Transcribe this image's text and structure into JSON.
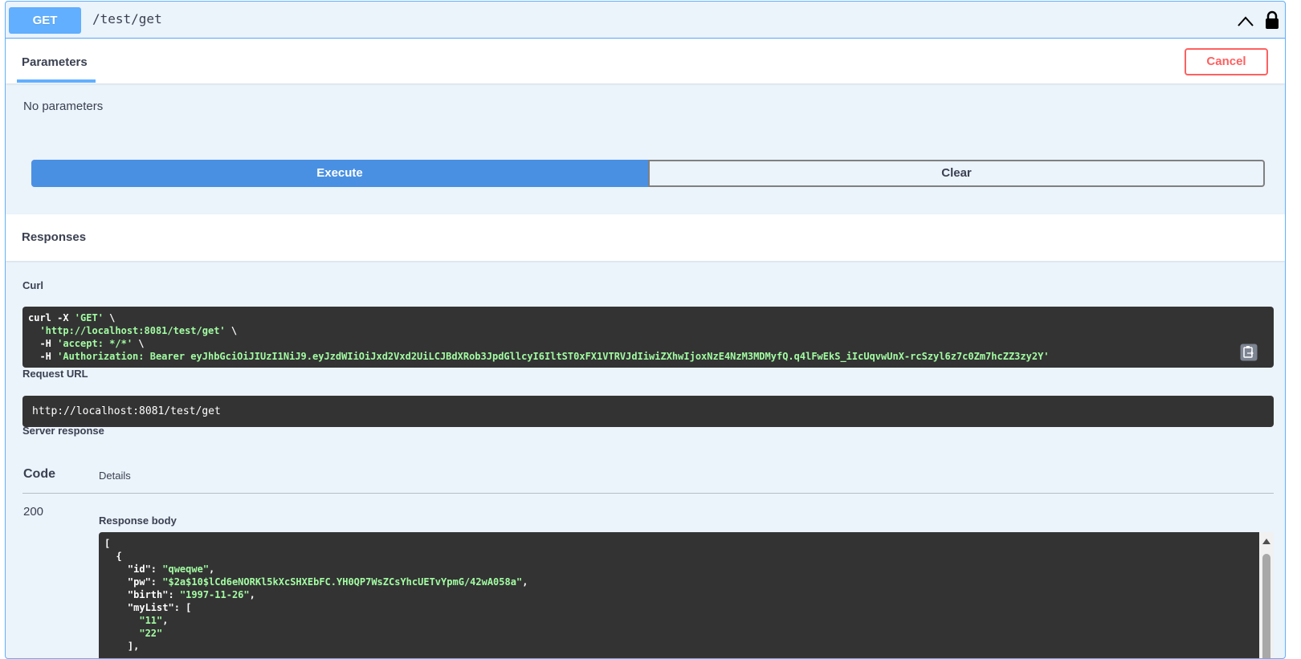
{
  "operation": {
    "method": "GET",
    "path": "/test/get",
    "icons": {
      "collapse": "chevron-up-icon",
      "lock": "lock-icon"
    }
  },
  "tabs": {
    "parameters": "Parameters",
    "cancel": "Cancel"
  },
  "parameters": {
    "empty_text": "No parameters"
  },
  "actions": {
    "execute": "Execute",
    "clear": "Clear"
  },
  "responses": {
    "title": "Responses",
    "curl_label": "Curl",
    "curl": {
      "l1_prefix": "curl -X ",
      "l1_str": "'GET'",
      "l1_suffix": " \\",
      "l2_prefix": "  ",
      "l2_str": "'http://localhost:8081/test/get'",
      "l2_suffix": " \\",
      "l3_prefix": "  -H ",
      "l3_str": "'accept: */*'",
      "l3_suffix": " \\",
      "l4_prefix": "  -H ",
      "l4_str": "'Authorization: Bearer eyJhbGciOiJIUzI1NiJ9.eyJzdWIiOiJxd2Vxd2UiLCJBdXRob3JpdGllcyI6IltST0xFX1VTRVJdIiwiZXhwIjoxNzE4NzM3MDMyfQ.q4lFwEkS_iIcUqvwUnX-rcSzyl6z7c0Zm7hcZZ3zy2Y'"
    },
    "request_url_label": "Request URL",
    "request_url": "http://localhost:8081/test/get",
    "server_response_label": "Server response",
    "col_code": "Code",
    "col_details": "Details",
    "status_code": "200",
    "response_body_label": "Response body",
    "body": {
      "l1": "[",
      "l2": "  {",
      "l3_key": "    \"id\"",
      "l3_sep": ": ",
      "l3_val": "\"qweqwe\"",
      "l3_end": ",",
      "l4_key": "    \"pw\"",
      "l4_sep": ": ",
      "l4_val": "\"$2a$10$lCd6eNORKl5kXcSHXEbFC.YH0QP7WsZCsYhcUETvYpmG/42wA058a\"",
      "l4_end": ",",
      "l5_key": "    \"birth\"",
      "l5_sep": ": ",
      "l5_val": "\"1997-11-26\"",
      "l5_end": ",",
      "l6_key": "    \"myList\"",
      "l6_sep": ": [",
      "l7_val": "      \"11\"",
      "l7_end": ",",
      "l8_val": "      \"22\"",
      "l9": "    ],"
    }
  },
  "colors": {
    "get": "#61affe",
    "cancel": "#ff6060",
    "execute": "#4990e2",
    "code_bg": "#333333",
    "string": "#a2fca2"
  }
}
